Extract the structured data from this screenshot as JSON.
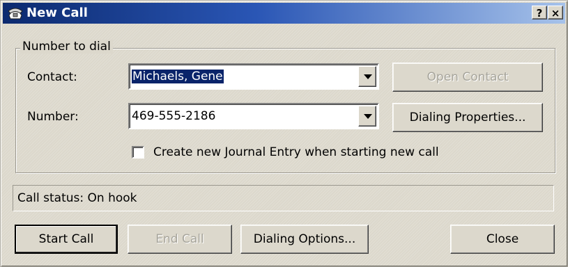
{
  "window": {
    "title": "New Call",
    "help_label": "?",
    "close_label": "×"
  },
  "group": {
    "legend": "Number to dial"
  },
  "contact": {
    "label": "Contact:",
    "value": "Michaels, Gene"
  },
  "number": {
    "label": "Number:",
    "value": "469-555-2186"
  },
  "buttons": {
    "open_contact": "Open Contact",
    "dialing_properties": "Dialing Properties...",
    "start_call": "Start Call",
    "end_call": "End Call",
    "dialing_options": "Dialing Options...",
    "close": "Close"
  },
  "journal_checkbox": {
    "label": "Create new Journal Entry when starting new call",
    "checked": false
  },
  "status": {
    "text": "Call status: On hook"
  },
  "colors": {
    "title_gradient_start": "#0c2a6f",
    "title_gradient_end": "#a6c2ea",
    "selection": "#0a246a",
    "dialog_face": "#dcd8cc"
  }
}
